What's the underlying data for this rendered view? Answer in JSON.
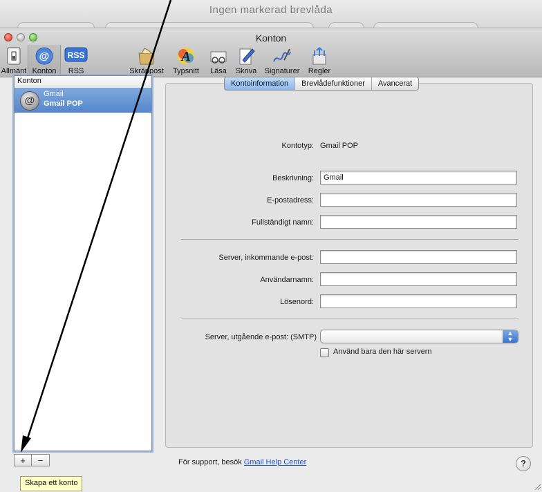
{
  "background_window": {
    "title": "Ingen markerad brevlåda"
  },
  "window": {
    "title": "Konton"
  },
  "toolbar": {
    "items": [
      {
        "label": "Allmänt",
        "icon": "switch-icon"
      },
      {
        "label": "Konton",
        "icon": "at-sign-icon"
      },
      {
        "label": "RSS",
        "icon": "rss-icon"
      },
      {
        "label": "Skräppost",
        "icon": "junk-mail-icon"
      },
      {
        "label": "Typsnitt",
        "icon": "fonts-icon"
      },
      {
        "label": "Läsa",
        "icon": "glasses-icon"
      },
      {
        "label": "Skriva",
        "icon": "pencil-icon"
      },
      {
        "label": "Signaturer",
        "icon": "signature-icon"
      },
      {
        "label": "Regler",
        "icon": "rules-icon"
      }
    ],
    "rss_badge": "RSS"
  },
  "sidebar": {
    "header": "Konton",
    "accounts": [
      {
        "name": "Gmail",
        "type": "Gmail POP"
      }
    ],
    "add_label": "+",
    "remove_label": "−",
    "tooltip": "Skapa ett konto"
  },
  "tabs": [
    {
      "label": "Kontoinformation",
      "active": true
    },
    {
      "label": "Brevlådefunktioner",
      "active": false
    },
    {
      "label": "Avancerat",
      "active": false
    }
  ],
  "form": {
    "account_type_label": "Kontotyp:",
    "account_type_value": "Gmail POP",
    "description_label": "Beskrivning:",
    "description_value": "Gmail",
    "email_label": "E-postadress:",
    "email_value": "",
    "fullname_label": "Fullständigt namn:",
    "fullname_value": "",
    "incoming_label": "Server, inkommande e-post:",
    "incoming_value": "",
    "username_label": "Användarnamn:",
    "username_value": "",
    "password_label": "Lösenord:",
    "password_value": "",
    "smtp_label": "Server, utgående e-post: (SMTP)",
    "smtp_value": "",
    "only_server_label": "Använd bara den här servern"
  },
  "footer": {
    "support_prefix": "För support, besök ",
    "support_link": "Gmail Help Center",
    "help_label": "?"
  },
  "colors": {
    "selection": "#5586cc",
    "link": "#1f4fd0",
    "tooltip": "#ffffc6"
  }
}
